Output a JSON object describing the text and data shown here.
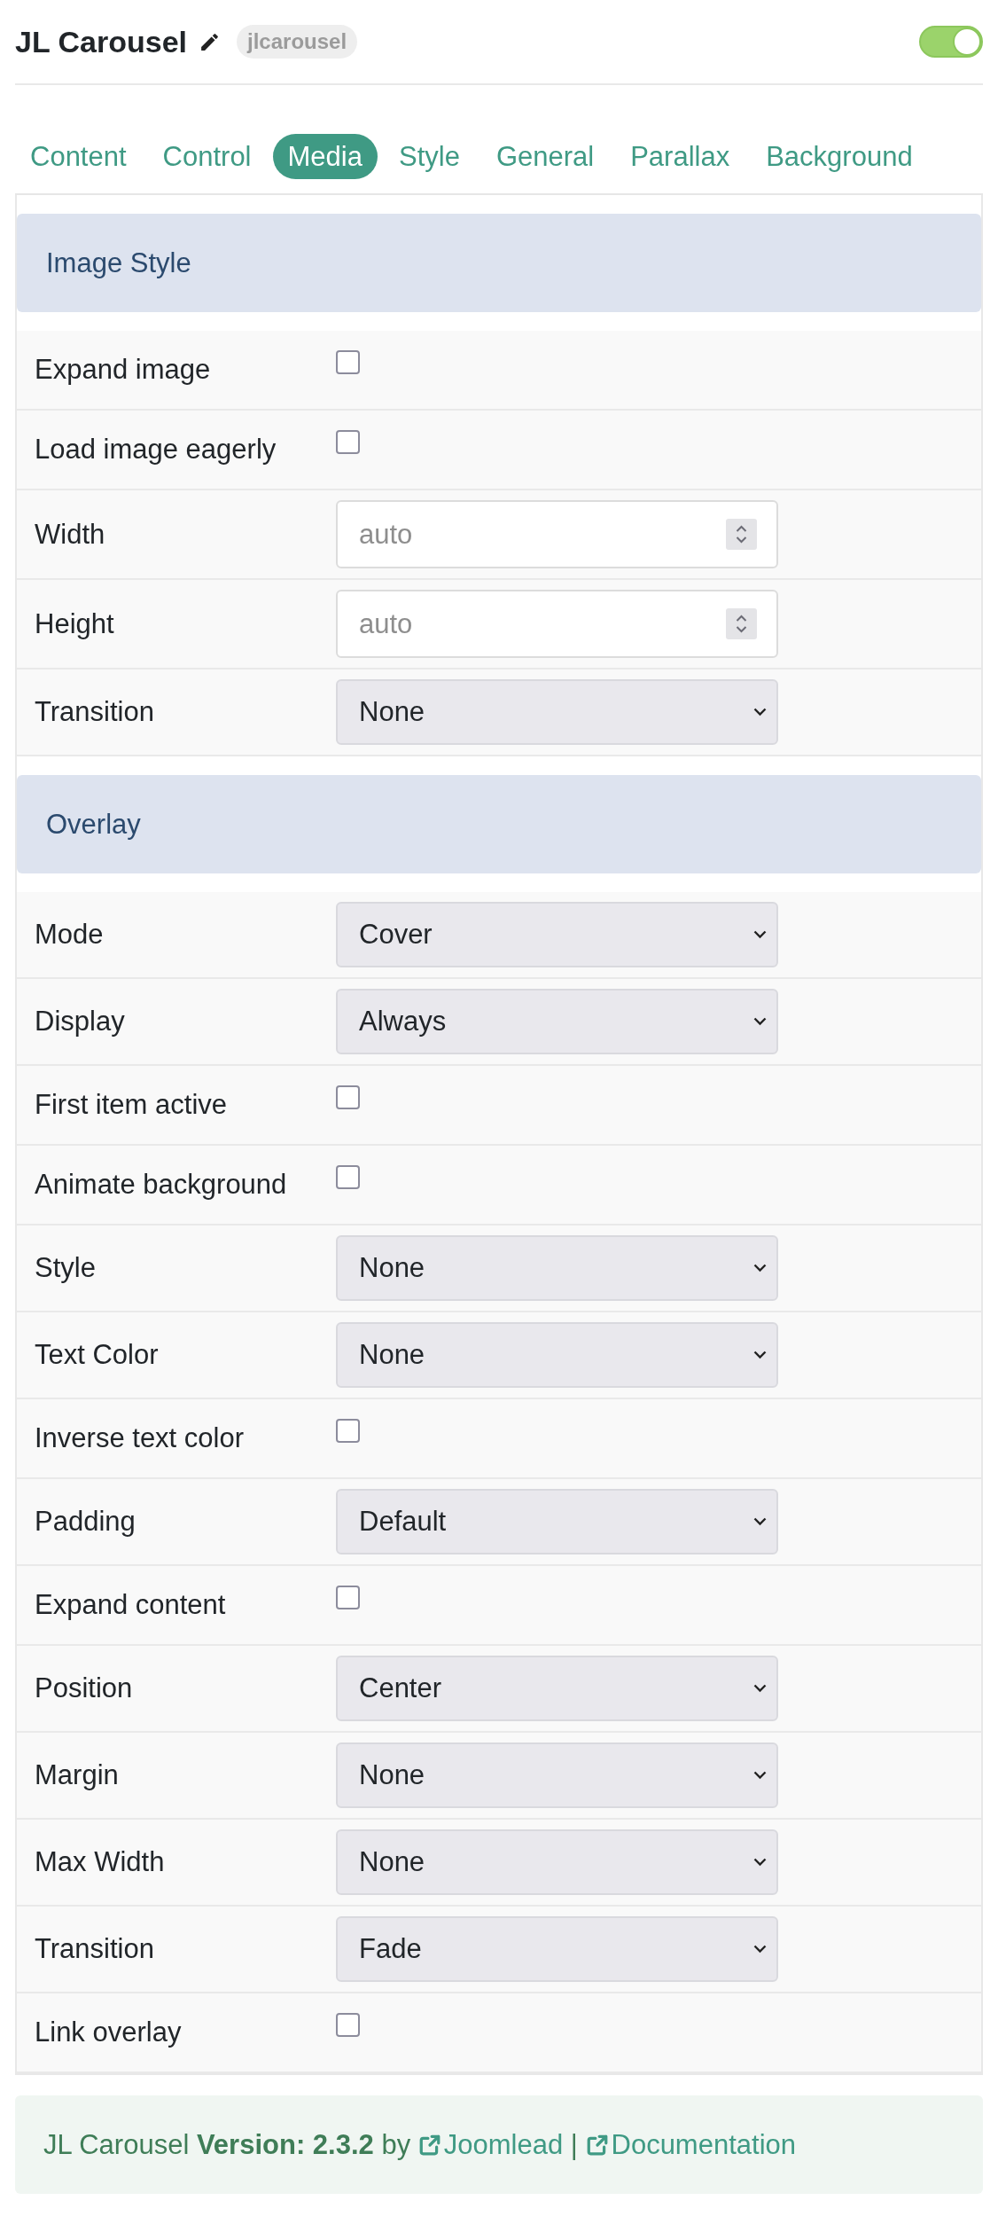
{
  "header": {
    "title": "JL Carousel",
    "badge": "jlcarousel",
    "enabled": true
  },
  "tabs": [
    {
      "label": "Content",
      "selected": false
    },
    {
      "label": "Control",
      "selected": false
    },
    {
      "label": "Media",
      "selected": true
    },
    {
      "label": "Style",
      "selected": false
    },
    {
      "label": "General",
      "selected": false
    },
    {
      "label": "Parallax",
      "selected": false
    },
    {
      "label": "Background",
      "selected": false
    }
  ],
  "sections": [
    {
      "title": "Image Style",
      "fields": [
        {
          "kind": "checkbox",
          "label": "Expand image",
          "checked": false
        },
        {
          "kind": "checkbox",
          "label": "Load image eagerly",
          "checked": false
        },
        {
          "kind": "number",
          "label": "Width",
          "placeholder": "auto"
        },
        {
          "kind": "number",
          "label": "Height",
          "placeholder": "auto"
        },
        {
          "kind": "select",
          "label": "Transition",
          "value": "None"
        }
      ]
    },
    {
      "title": "Overlay",
      "fields": [
        {
          "kind": "select",
          "label": "Mode",
          "value": "Cover"
        },
        {
          "kind": "select",
          "label": "Display",
          "value": "Always"
        },
        {
          "kind": "checkbox",
          "label": "First item active",
          "checked": false
        },
        {
          "kind": "checkbox",
          "label": "Animate background",
          "checked": false
        },
        {
          "kind": "select",
          "label": "Style",
          "value": "None"
        },
        {
          "kind": "select",
          "label": "Text Color",
          "value": "None"
        },
        {
          "kind": "checkbox",
          "label": "Inverse text color",
          "checked": false
        },
        {
          "kind": "select",
          "label": "Padding",
          "value": "Default"
        },
        {
          "kind": "checkbox",
          "label": "Expand content",
          "checked": false
        },
        {
          "kind": "select",
          "label": "Position",
          "value": "Center"
        },
        {
          "kind": "select",
          "label": "Margin",
          "value": "None"
        },
        {
          "kind": "select",
          "label": "Max Width",
          "value": "None"
        },
        {
          "kind": "select",
          "label": "Transition",
          "value": "Fade"
        },
        {
          "kind": "checkbox",
          "label": "Link overlay",
          "checked": false
        }
      ]
    }
  ],
  "footer": {
    "parts": [
      {
        "kind": "text",
        "text": "JL Carousel **Version: 2.3.2** by"
      },
      {
        "kind": "link",
        "label": "Joomlead"
      },
      {
        "kind": "text",
        "text": "|"
      },
      {
        "kind": "link",
        "label": "Documentation"
      }
    ]
  }
}
